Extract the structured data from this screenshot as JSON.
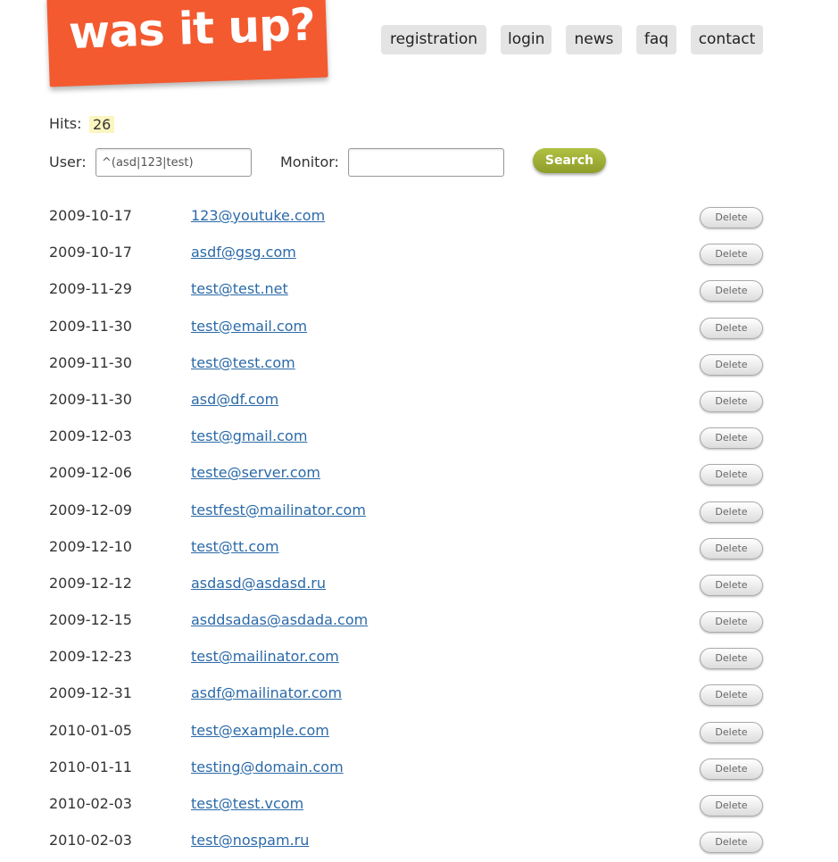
{
  "logo": {
    "text": "was it up?",
    "color": "#f35a30"
  },
  "nav": [
    {
      "label": "registration"
    },
    {
      "label": "login"
    },
    {
      "label": "news"
    },
    {
      "label": "faq"
    },
    {
      "label": "contact"
    }
  ],
  "hits": {
    "label": "Hits:",
    "value": "26"
  },
  "filters": {
    "user_label": "User:",
    "user_value": "^(asd|123|test)",
    "monitor_label": "Monitor:",
    "monitor_value": "",
    "search_label": "Search"
  },
  "delete_label": "Delete",
  "rows": [
    {
      "date": "2009-10-17",
      "email": "123@youtuke.com"
    },
    {
      "date": "2009-10-17",
      "email": "asdf@gsg.com"
    },
    {
      "date": "2009-11-29",
      "email": "test@test.net"
    },
    {
      "date": "2009-11-30",
      "email": "test@email.com"
    },
    {
      "date": "2009-11-30",
      "email": "test@test.com"
    },
    {
      "date": "2009-11-30",
      "email": "asd@df.com"
    },
    {
      "date": "2009-12-03",
      "email": "test@gmail.com"
    },
    {
      "date": "2009-12-06",
      "email": "teste@server.com"
    },
    {
      "date": "2009-12-09",
      "email": "testfest@mailinator.com"
    },
    {
      "date": "2009-12-10",
      "email": "test@tt.com"
    },
    {
      "date": "2009-12-12",
      "email": "asdasd@asdasd.ru"
    },
    {
      "date": "2009-12-15",
      "email": "asddsadas@asdada.com"
    },
    {
      "date": "2009-12-23",
      "email": "test@mailinator.com"
    },
    {
      "date": "2009-12-31",
      "email": "asdf@mailinator.com"
    },
    {
      "date": "2010-01-05",
      "email": "test@example.com"
    },
    {
      "date": "2010-01-11",
      "email": "testing@domain.com"
    },
    {
      "date": "2010-02-03",
      "email": "test@test.vcom"
    },
    {
      "date": "2010-02-03",
      "email": "test@nospam.ru"
    }
  ]
}
